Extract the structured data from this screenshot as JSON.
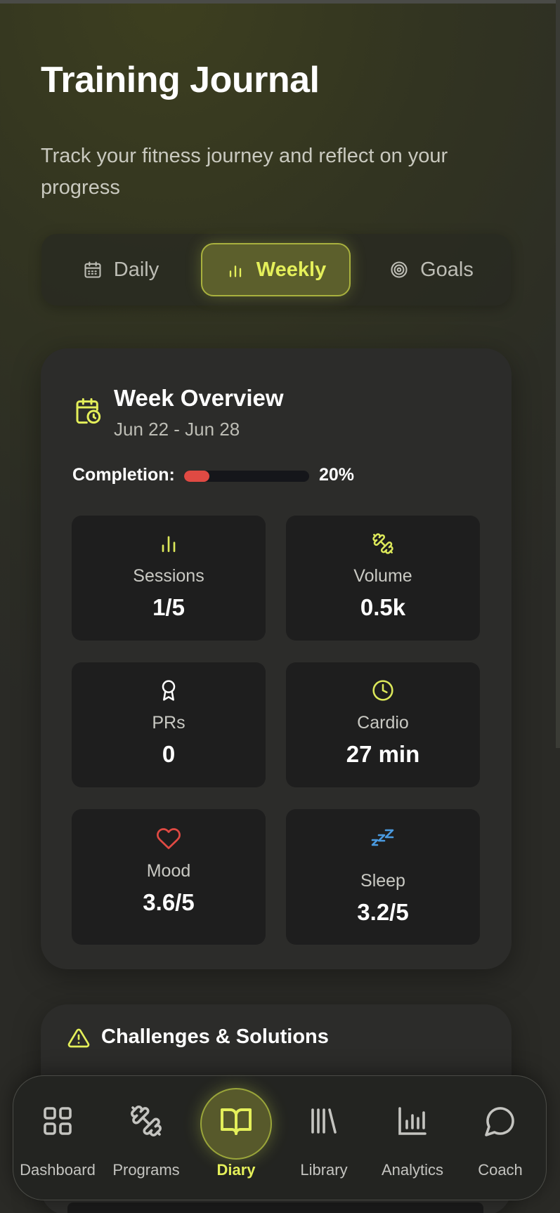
{
  "header": {
    "title": "Training Journal",
    "subtitle": "Track your fitness journey and reflect on your progress"
  },
  "tabs": [
    {
      "label": "Daily",
      "icon": "calendar-icon",
      "active": false
    },
    {
      "label": "Weekly",
      "icon": "bar-chart-icon",
      "active": true
    },
    {
      "label": "Goals",
      "icon": "target-icon",
      "active": false
    }
  ],
  "week": {
    "title": "Week Overview",
    "range": "Jun 22 - Jun 28",
    "completion_label": "Completion:",
    "completion_pct": "20%",
    "completion_value": 0.2,
    "stats": [
      {
        "label": "Sessions",
        "value": "1/5",
        "icon": "bar-chart-icon",
        "color": "#dce85a"
      },
      {
        "label": "Volume",
        "value": "0.5k",
        "icon": "dumbbell-icon",
        "color": "#dce85a"
      },
      {
        "label": "PRs",
        "value": "0",
        "icon": "award-icon",
        "color": "#ffffff"
      },
      {
        "label": "Cardio",
        "value": "27 min",
        "icon": "clock-icon",
        "color": "#dce85a"
      },
      {
        "label": "Mood",
        "value": "3.6/5",
        "icon": "heart-icon",
        "color": "#e04a43"
      },
      {
        "label": "Sleep",
        "value": "3.2/5",
        "icon": "zzz-icon",
        "color": "#4a9ae0"
      }
    ]
  },
  "challenges": {
    "title": "Challenges & Solutions",
    "icon": "warning-icon"
  },
  "nav": [
    {
      "label": "Dashboard",
      "icon": "grid-icon"
    },
    {
      "label": "Programs",
      "icon": "dumbbell-icon"
    },
    {
      "label": "Diary",
      "icon": "book-icon",
      "active": true
    },
    {
      "label": "Library",
      "icon": "library-icon"
    },
    {
      "label": "Analytics",
      "icon": "analytics-icon"
    },
    {
      "label": "Coach",
      "icon": "chat-icon"
    }
  ],
  "colors": {
    "accent": "#e4ef5a",
    "danger": "#e04a43",
    "card": "#2c2c2a",
    "stat_tile": "#1e1e1e"
  }
}
